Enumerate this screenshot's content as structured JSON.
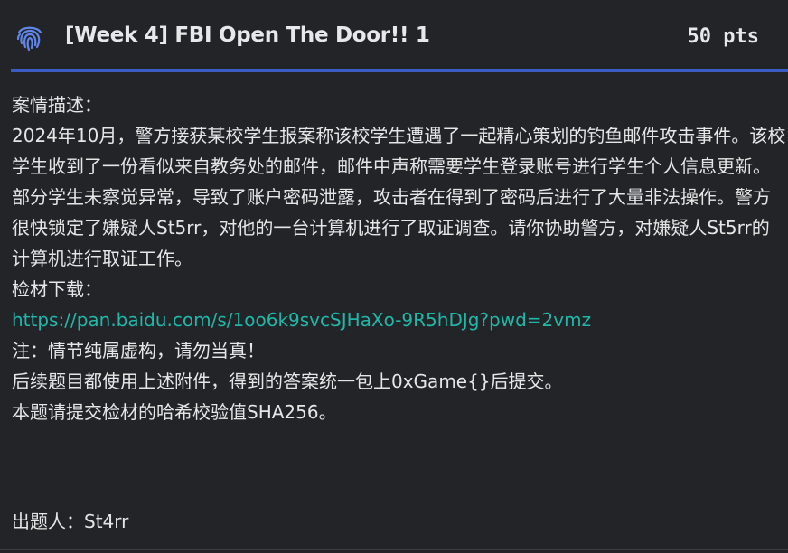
{
  "challenge": {
    "title": "[Week 4] FBI Open The Door!! 1",
    "points": "50 pts"
  },
  "description": {
    "heading": "案情描述：",
    "body": "2024年10月，警方接获某校学生报案称该校学生遭遇了一起精心策划的钓鱼邮件攻击事件。该校学生收到了一份看似来自教务处的邮件，邮件中声称需要学生登录账号进行学生个人信息更新。部分学生未察觉异常，导致了账户密码泄露，攻击者在得到了密码后进行了大量非法操作。警方很快锁定了嫌疑人St5rr，对他的一台计算机进行了取证调查。请你协助警方，对嫌疑人St5rr的计算机进行取证工作。",
    "download_label": "检材下载：",
    "download_link": "https://pan.baidu.com/s/1oo6k9svcSJHaXo-9R5hDJg?pwd=2vmz",
    "note": "注：情节纯属虚构，请勿当真！",
    "instruction_1": "后续题目都使用上述附件，得到的答案统一包上0xGame{}后提交。",
    "instruction_2": "本题请提交检材的哈希校验值SHA256。"
  },
  "author": "出题人：St4rr",
  "colors": {
    "background": "#222428",
    "accent": "#3b5cc4",
    "link": "#1fb8a8",
    "icon": "#5f86e8"
  },
  "icons": {
    "challenge_icon": "fingerprint-icon"
  }
}
